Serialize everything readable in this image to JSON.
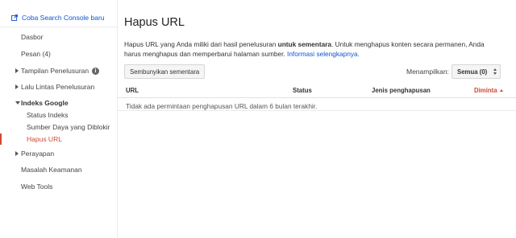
{
  "sidebar": {
    "try_link_label": "Coba Search Console baru",
    "items": [
      {
        "label": "Dasbor"
      },
      {
        "label": "Pesan (4)"
      },
      {
        "label": "Tampilan Penelusuran"
      },
      {
        "label": "Lalu Lintas Penelusuran"
      },
      {
        "label": "Indeks Google"
      },
      {
        "label": "Status Indeks"
      },
      {
        "label": "Sumber Daya yang Diblokir"
      },
      {
        "label": "Hapus URL"
      },
      {
        "label": "Perayapan"
      },
      {
        "label": "Masalah Keamanan"
      },
      {
        "label": "Web Tools"
      }
    ],
    "info_icon_glyph": "i"
  },
  "main": {
    "title": "Hapus URL",
    "description": {
      "part1": "Hapus URL yang Anda miliki dari hasil penelusuran ",
      "bold": "untuk sementara",
      "part2": ". Untuk menghapus konten secara permanen, Anda harus menghapus dan memperbarui halaman sumber. ",
      "link": "Informasi selengkapnya."
    },
    "hide_button_label": "Sembunyikan sementara",
    "show_label": "Menampilkan:",
    "show_select_value": "Semua (0)",
    "table": {
      "columns": [
        "URL",
        "Status",
        "Jenis penghapusan",
        "Diminta"
      ],
      "empty_message": "Tidak ada permintaan penghapusan URL dalam 6 bulan terakhir."
    }
  },
  "colors": {
    "accent": "#d14836",
    "link": "#1155cc"
  }
}
